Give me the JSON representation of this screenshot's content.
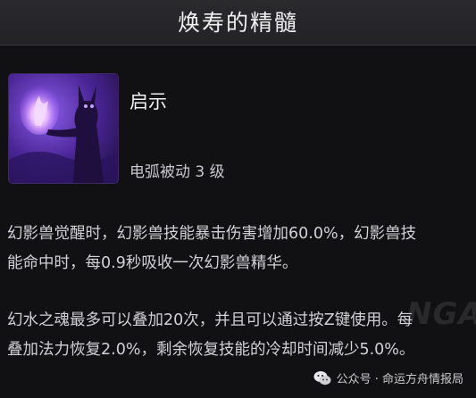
{
  "tooltip": {
    "title": "焕寿的精髓",
    "skill": {
      "icon": "purple-spirit-figure-icon",
      "name": "启示",
      "type": "电弧被动 3 级"
    },
    "description": [
      "幻影兽觉醒时，幻影兽技能暴击伤害增加60.0%，幻影兽技能命中时，每0.9秒吸收一次幻影兽精华。",
      "幻水之魂最多可以叠加20次，并且可以通过按Z键使用。每叠加法力恢复2.0%，剩余恢复技能的冷却时间减少5.0%。"
    ]
  },
  "watermark": {
    "logo": "NGA",
    "text": "公众号 · 命运方舟情报局",
    "icon": "wechat-icon"
  },
  "colors": {
    "background": "#111113",
    "title_bar": "#2a2a2d",
    "icon_purple": "#6a3cc8",
    "text": "#d2d2d6"
  }
}
